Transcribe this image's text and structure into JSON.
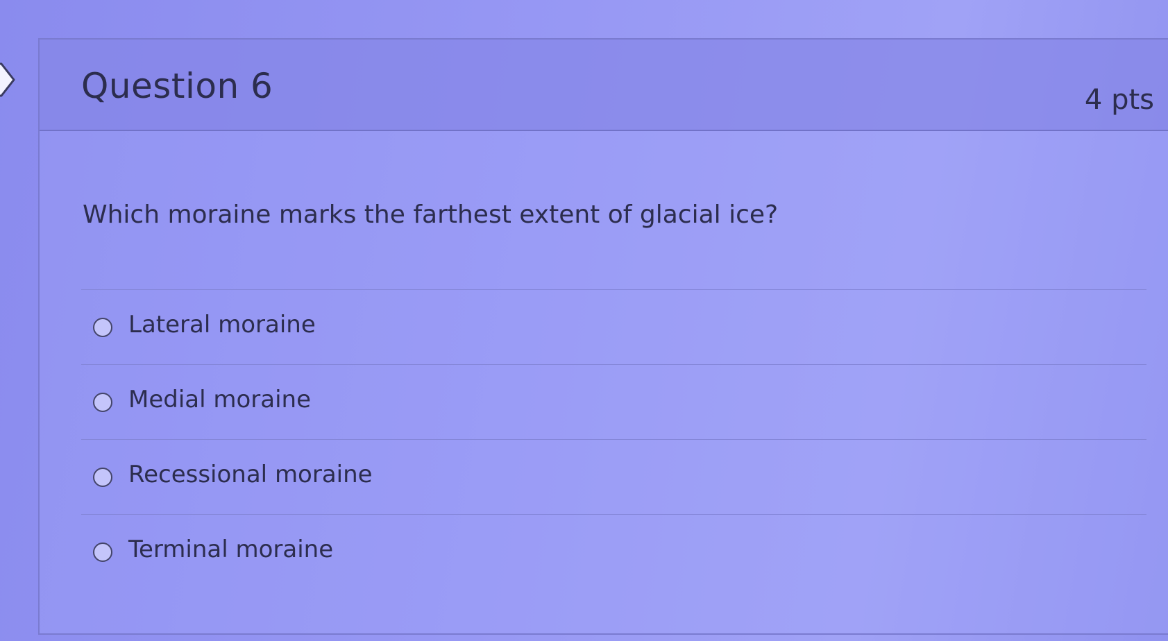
{
  "question": {
    "title": "Question 6",
    "points": "4 pts",
    "text": "Which moraine marks the farthest extent of glacial ice?",
    "answers": [
      {
        "label": "Lateral moraine"
      },
      {
        "label": "Medial moraine"
      },
      {
        "label": "Recessional moraine"
      },
      {
        "label": "Terminal moraine"
      }
    ]
  },
  "icons": {
    "nav": "chevron-right-icon",
    "radio": "radio-unselected"
  }
}
